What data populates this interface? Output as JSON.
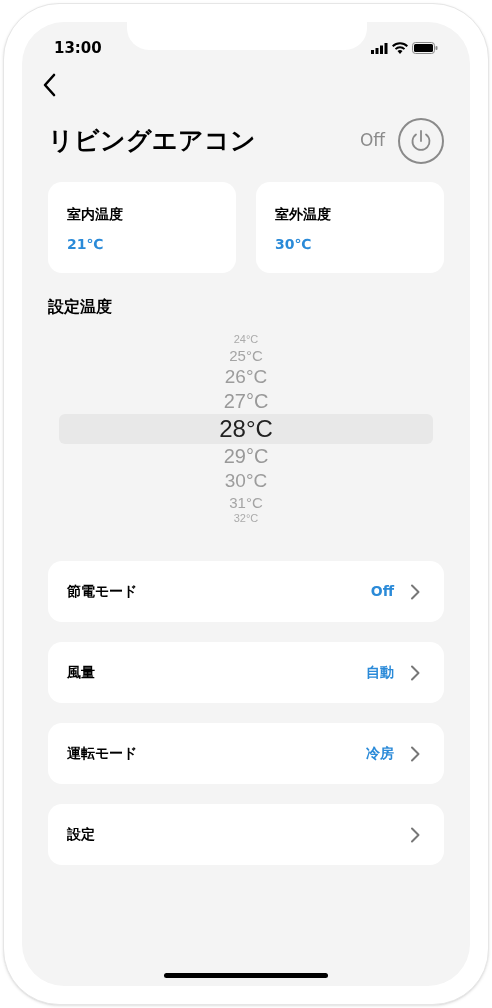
{
  "status_bar": {
    "time": "13:00"
  },
  "title": "リビングエアコン",
  "power": {
    "label": "Off",
    "on": false
  },
  "temperatures": [
    {
      "label": "室内温度",
      "value": "21℃"
    },
    {
      "label": "室外温度",
      "value": "30℃"
    }
  ],
  "setpoint": {
    "label": "設定温度",
    "options": [
      {
        "label": "24°C",
        "selected": false
      },
      {
        "label": "25°C",
        "selected": false
      },
      {
        "label": "26°C",
        "selected": false
      },
      {
        "label": "27°C",
        "selected": false
      },
      {
        "label": "28°C",
        "selected": true
      },
      {
        "label": "29°C",
        "selected": false
      },
      {
        "label": "30°C",
        "selected": false
      },
      {
        "label": "31°C",
        "selected": false
      },
      {
        "label": "32°C",
        "selected": false
      }
    ]
  },
  "settings": [
    {
      "label": "節電モード",
      "value": "Off"
    },
    {
      "label": "風量",
      "value": "自動"
    },
    {
      "label": "運転モード",
      "value": "冷房"
    },
    {
      "label": "設定"
    }
  ]
}
